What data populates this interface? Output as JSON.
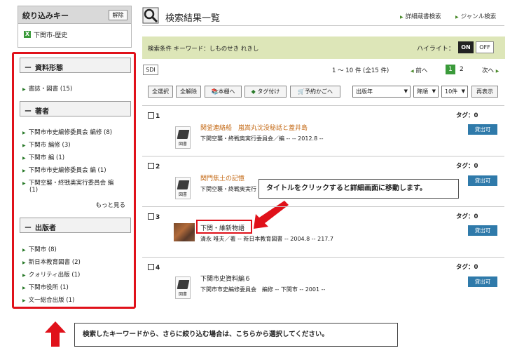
{
  "sidebar": {
    "header": "絞り込みキー",
    "clear_button": "解除",
    "active_key": "下関市-歴史",
    "active_key_mark": "X",
    "sections": [
      {
        "title": "資料形態",
        "items": [
          "書誌・図書 (15)"
        ]
      },
      {
        "title": "著者",
        "items": [
          "下関市市史編修委員会 編修 (8)",
          "下関市 編修 (3)",
          "下関市 編 (1)",
          "下関市市史編修委員会 編 (1)",
          "下関空襲・終戦奥実行委員会 編",
          "(1)"
        ],
        "more": "もっと見る"
      },
      {
        "title": "出版者",
        "items": [
          "下関市 (8)",
          "新日本教育図書 (2)",
          "クォリティ出版 (1)",
          "下関市役所 (1)",
          "文一総合出版 (1)"
        ]
      }
    ]
  },
  "header": {
    "title": "検索結果一覧",
    "link_detail": "詳細蔵書検索",
    "link_genre": "ジャンル検索"
  },
  "conditions": {
    "text": "検索条件  キーワード：しものせき れきし",
    "highlight_label": "ハイライト：",
    "on": "ON",
    "off": "OFF"
  },
  "pager": {
    "sdi": "SDI",
    "count": "1 〜 10 件 (全15 件)",
    "prev": "前へ",
    "current": "1",
    "page2": "2",
    "next": "次へ"
  },
  "toolbar": {
    "select_all": "全選択",
    "deselect_all": "全解除",
    "bookshelf": "本棚へ",
    "tag": "タグ付け",
    "cart": "予約かごへ",
    "sort_field": "出版年",
    "sort_order": "降順",
    "per_page": "10件",
    "redisplay": "再表示"
  },
  "results": [
    {
      "num": "1",
      "tag": "タグ：0",
      "title": "関釜連絡船　嵐嵩丸沈没秘話と蓋井島",
      "meta": "下関空襲・終戦奥実行委員会／編 -- -- 2012.8 --",
      "status": "貸出可",
      "icon_label": "図書"
    },
    {
      "num": "2",
      "tag": "タグ：0",
      "title": "関門焦土の記憶",
      "meta": "下関空襲・終戦奥実行",
      "status": "貸出可",
      "icon_label": "図書"
    },
    {
      "num": "3",
      "tag": "タグ：0",
      "title": "下関・維新物語",
      "meta": "清永 唯夫／著 -- 新日本教育図書 -- 2004.8 -- 217.7",
      "status": "貸出可"
    },
    {
      "num": "4",
      "tag": "タグ：0",
      "title": "下関市史資料編６",
      "meta": "下関市市史編修委員会　編修 -- 下関市 -- 2001 --",
      "status": "貸出可",
      "icon_label": "図書"
    }
  ],
  "annotations": {
    "callout": "タイトルをクリックすると詳細画面に移動します。",
    "note": "検索したキーワードから、さらに絞り込む場合は、こちらから選択してください。"
  },
  "colors": {
    "highlight_red": "#e0111a",
    "result_title_orange": "#c46a16",
    "status_blue": "#2f7aaa",
    "condition_bg": "#dde6b8"
  }
}
